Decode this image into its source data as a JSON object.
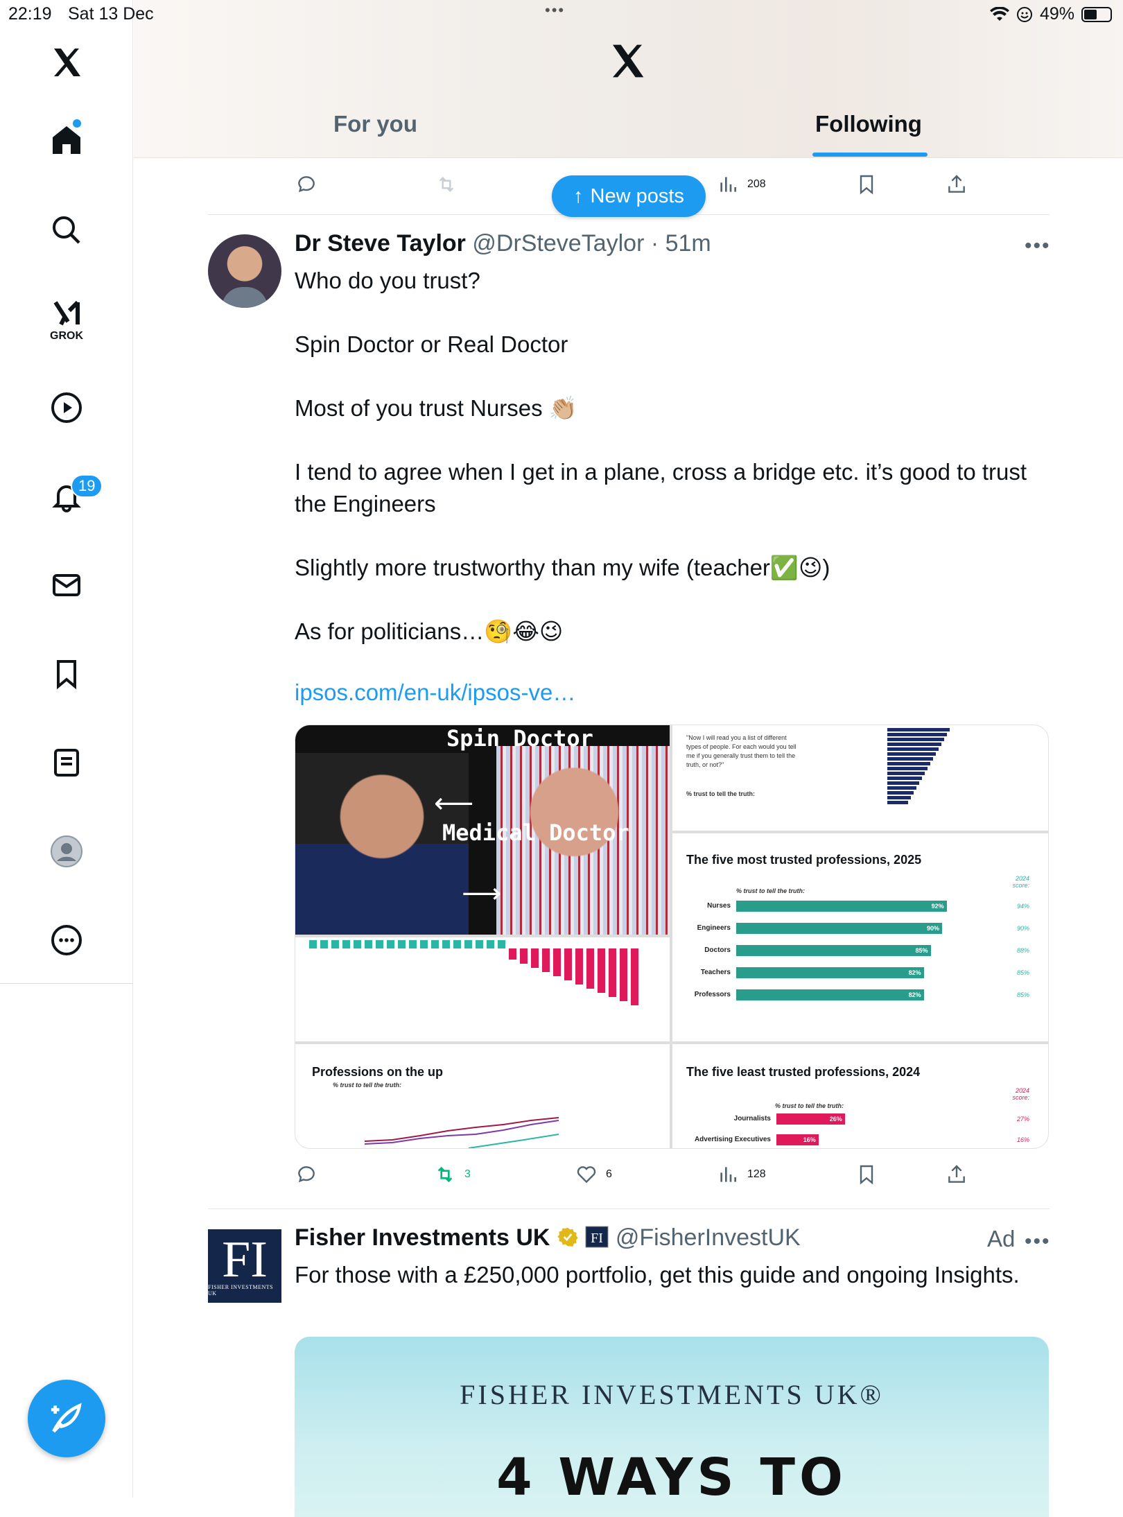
{
  "status_bar": {
    "time": "22:19",
    "date": "Sat 13 Dec",
    "battery": "49%"
  },
  "sidebar": {
    "grok_label": "GROK",
    "notifications_badge": "19"
  },
  "header": {
    "tabs": [
      {
        "label": "For you",
        "active": false
      },
      {
        "label": "Following",
        "active": true
      }
    ]
  },
  "new_posts_label": "New posts",
  "prev_post": {
    "views": "208"
  },
  "post": {
    "author_name": "Dr Steve Taylor",
    "author_meta": "@DrSteveTaylor · 51m",
    "body": "Who do you trust?\n\nSpin Doctor or Real Doctor\n\nMost of you trust Nurses 👏🏼\n\nI tend to agree when I get in a plane, cross a bridge etc. it’s good to trust the Engineers\n\nSlightly more trustworthy than my wife (teacher✅😉)\n\nAs for politicians…🧐😂😉",
    "link": "ipsos.com/en-uk/ipsos-ve…",
    "image": {
      "overlay_top": "Spin\nDoctor",
      "overlay_bottom": "Medical\nDoctor",
      "top5_title": "The five most trusted professions, 2025",
      "subtitle": "% trust to tell the truth:",
      "score_header": "2024 score:",
      "top5": [
        {
          "label": "Nurses",
          "value": "92%",
          "pct": 92,
          "prev": "94%"
        },
        {
          "label": "Engineers",
          "value": "90%",
          "pct": 90,
          "prev": "90%"
        },
        {
          "label": "Doctors",
          "value": "85%",
          "pct": 85,
          "prev": "88%"
        },
        {
          "label": "Teachers",
          "value": "82%",
          "pct": 82,
          "prev": "85%"
        },
        {
          "label": "Professors",
          "value": "82%",
          "pct": 82,
          "prev": "85%"
        }
      ],
      "least_title": "The five least trusted professions, 2024",
      "least": [
        {
          "label": "Journalists",
          "value": "26%",
          "pct": 26,
          "prev": "27%"
        },
        {
          "label": "Advertising Executives",
          "value": "16%",
          "pct": 16,
          "prev": "16%"
        }
      ],
      "up_title": "Professions on the up",
      "question": "\"Now I will read you a list of different types of people. For each would you tell me if you generally trust them to tell the truth, or not?\""
    },
    "stats": {
      "replies": "",
      "reposts": "3",
      "likes": "6",
      "views": "128"
    }
  },
  "ad": {
    "name": "Fisher Investments UK",
    "handle": "@FisherInvestUK",
    "ad_label": "Ad",
    "body": "For those with a £250,000 portfolio, get this guide and ongoing Insights.",
    "avatar_text": "FI",
    "avatar_small": "FISHER INVESTMENTS UK",
    "card_brand": "FISHER INVESTMENTS UK®",
    "card_headline": "4 WAYS TO"
  },
  "colors": {
    "accent": "#1d9bf0",
    "teal": "#2a9d8a",
    "magenta": "#e0195b",
    "repost_green": "#00ba7c"
  }
}
